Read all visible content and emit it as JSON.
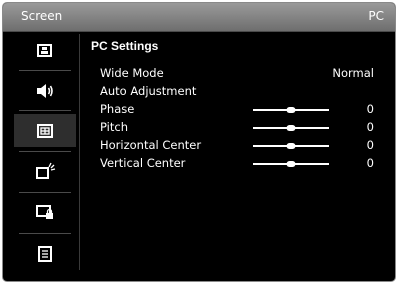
{
  "window": {
    "title": "Screen",
    "source": "PC"
  },
  "sidebar": {
    "items": [
      {
        "icon": "picture-icon",
        "selected": false
      },
      {
        "icon": "speaker-icon",
        "selected": false
      },
      {
        "icon": "screen-icon",
        "selected": true
      },
      {
        "icon": "display-settings-icon",
        "selected": false
      },
      {
        "icon": "lock-icon",
        "selected": false
      },
      {
        "icon": "menu-list-icon",
        "selected": false
      }
    ]
  },
  "main": {
    "heading": "PC Settings",
    "rows": [
      {
        "label": "Wide Mode",
        "value": "Normal"
      },
      {
        "label": "Auto Adjustment"
      },
      {
        "label": "Phase",
        "value": "0",
        "slider": 0.5
      },
      {
        "label": "Pitch",
        "value": "0",
        "slider": 0.5
      },
      {
        "label": "Horizontal Center",
        "value": "0",
        "slider": 0.5
      },
      {
        "label": "Vertical Center",
        "value": "0",
        "slider": 0.5
      }
    ]
  },
  "colors": {
    "background": "#000000",
    "titlebar": "#8a8a8a",
    "text": "#ffffff",
    "selected": "#2e2e2e"
  }
}
